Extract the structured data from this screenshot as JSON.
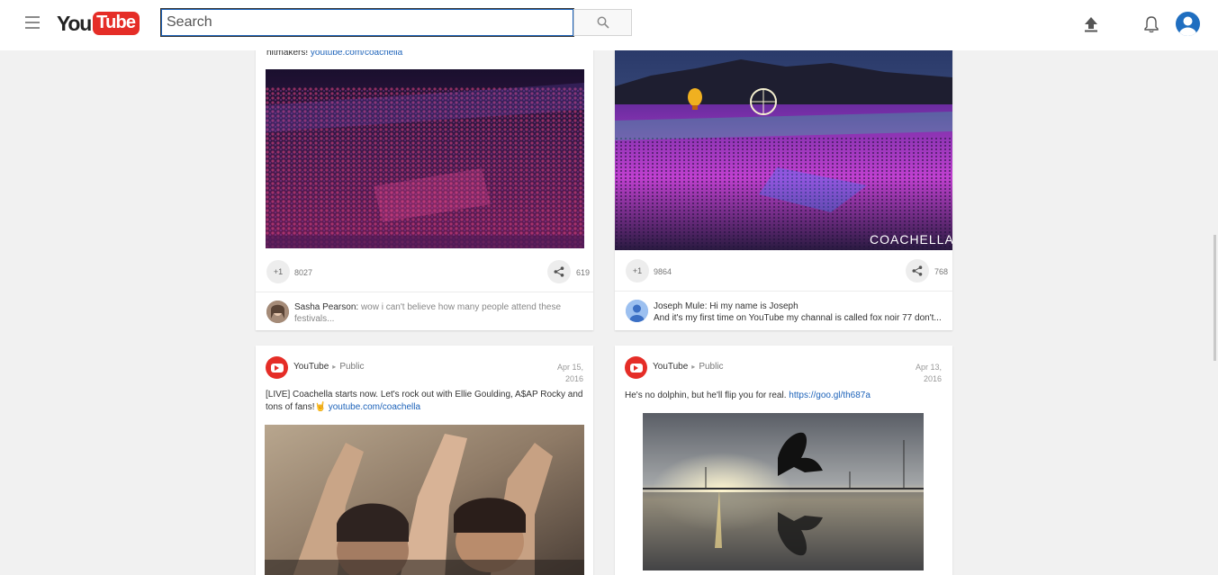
{
  "masthead": {
    "logo_you": "You",
    "logo_tube": "Tube",
    "search_placeholder": "Search"
  },
  "cards": [
    {
      "text_visible": "hitmakers!",
      "link": "youtube.com/coachella",
      "plus_label": "+1",
      "plus_count": "8027",
      "share_count": "619",
      "comment": {
        "author": "Sasha Pearson:",
        "text": "wow i can't believe how many people attend these festivals..."
      }
    },
    {
      "plus_label": "+1",
      "plus_count": "9864",
      "share_count": "768",
      "image_watermark": "COACHELLA",
      "comment": {
        "author": "Joseph Mule:",
        "text_line1": "Hi my name is Joseph",
        "text_line2": "And it's my first time on YouTube my channal is called fox noir 77 don't..."
      }
    },
    {
      "channel": "YouTube",
      "visibility": "Public",
      "date_line1": "Apr 15,",
      "date_line2": "2016",
      "text": "[LIVE] Coachella starts now. Let's rock out with Ellie Goulding, A$AP Rocky and tons of fans!",
      "emoji": "🤘",
      "link": "youtube.com/coachella"
    },
    {
      "channel": "YouTube",
      "visibility": "Public",
      "date_line1": "Apr 13,",
      "date_line2": "2016",
      "text": "He's no dolphin, but he'll flip you for real.",
      "link": "https://goo.gl/th687a"
    }
  ],
  "icons": {
    "menu": "hamburger-menu-icon",
    "search": "search-icon",
    "upload": "upload-icon",
    "notifications": "bell-icon",
    "account": "account-avatar-icon",
    "share": "share-icon"
  },
  "colors": {
    "brand_red": "#e52d27",
    "link_blue": "#1c62b9",
    "page_bg": "#f1f1f1"
  }
}
